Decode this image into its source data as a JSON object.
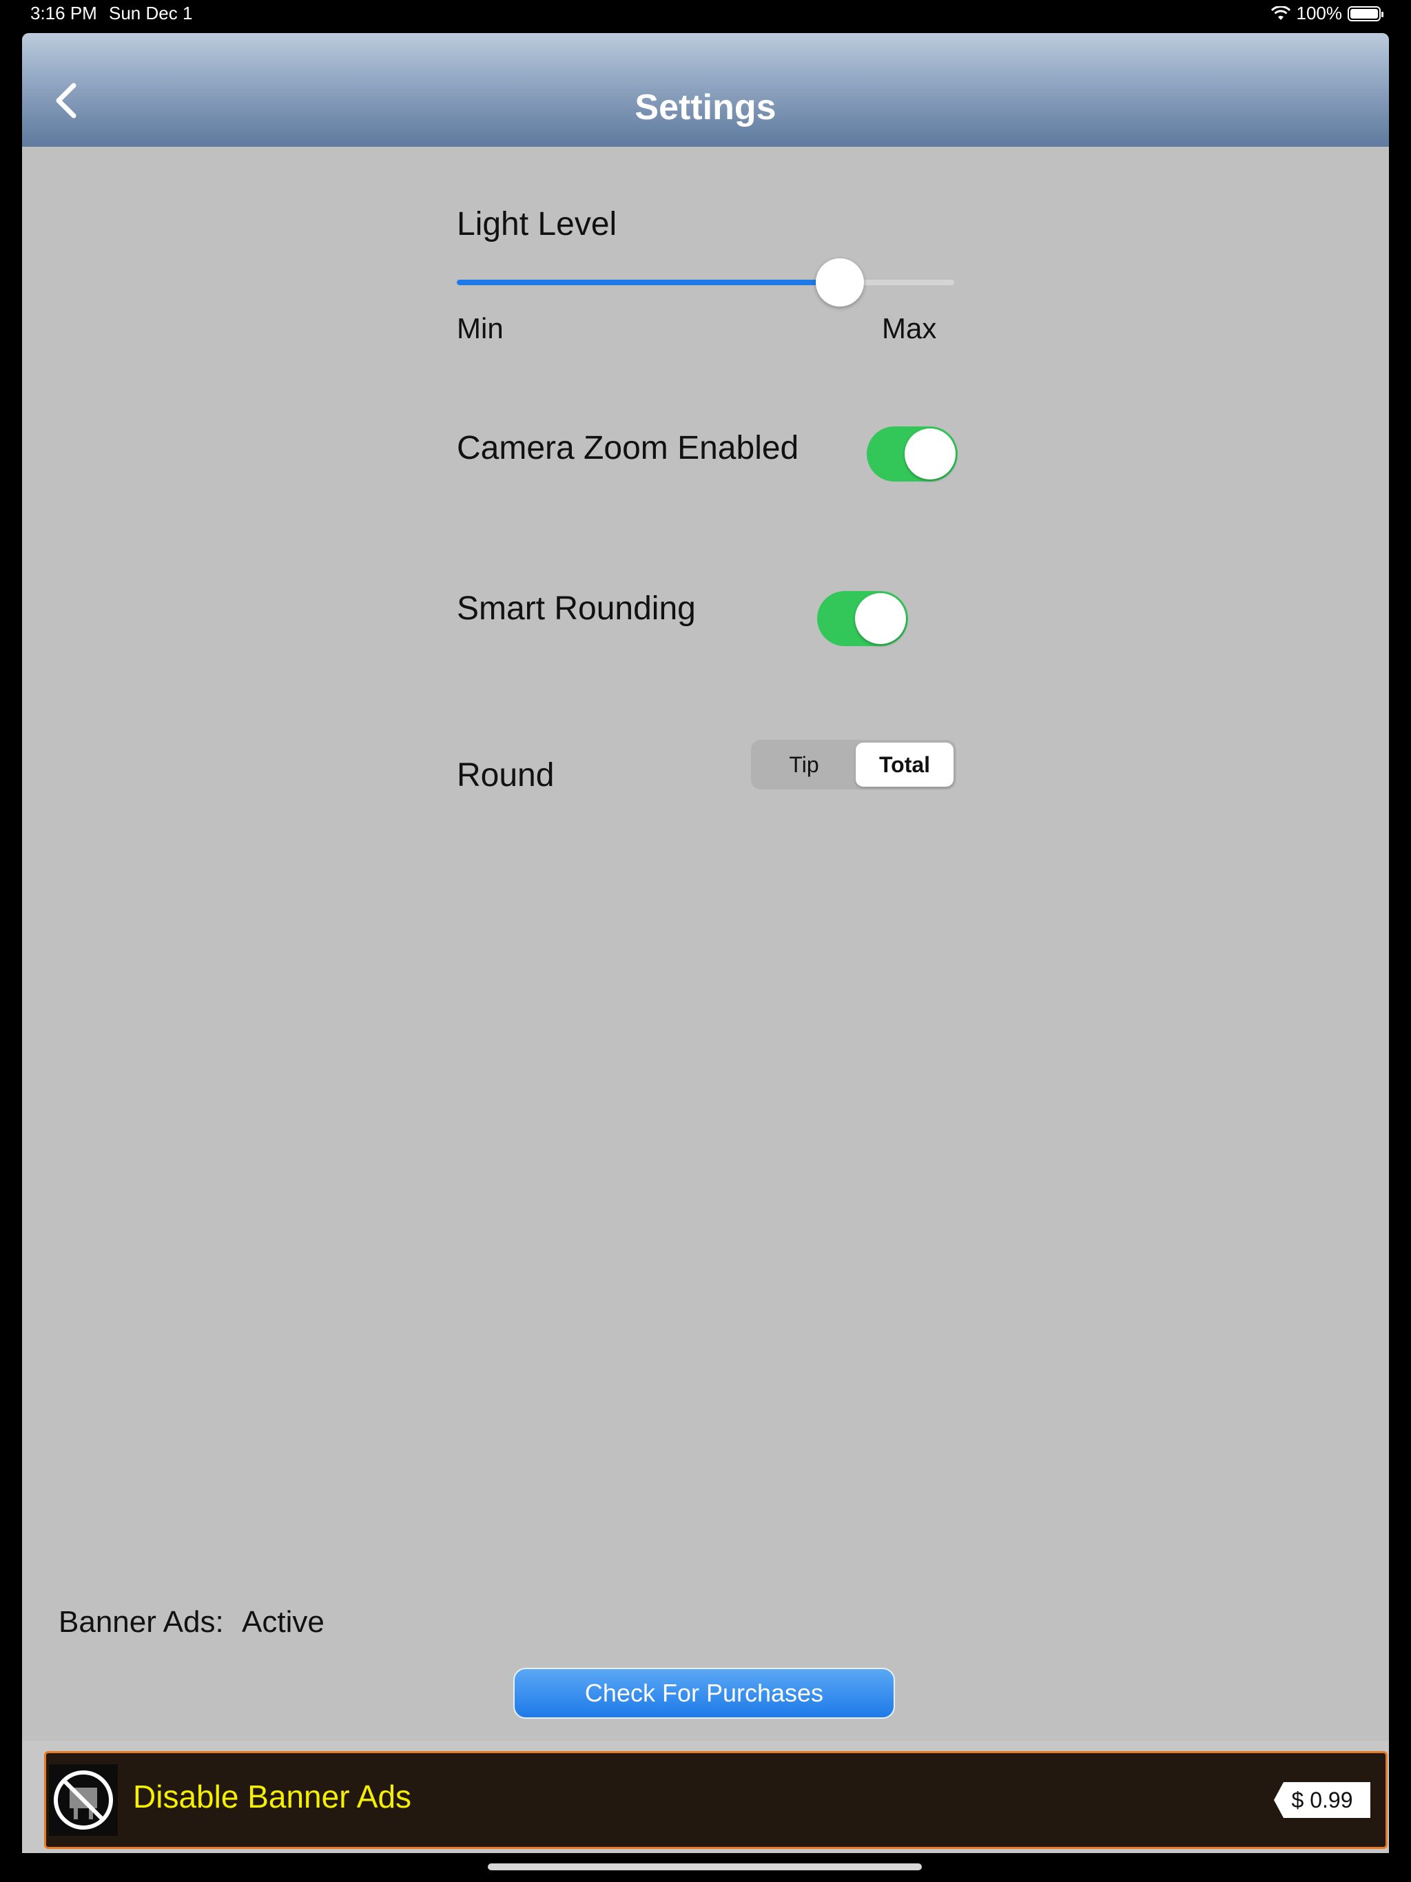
{
  "status_bar": {
    "time": "3:16 PM",
    "date": "Sun Dec 1",
    "battery": "100%",
    "battery_level": 1.0
  },
  "nav": {
    "title": "Settings"
  },
  "light_level": {
    "label": "Light Level",
    "min_label": "Min",
    "max_label": "Max",
    "value": 0.77
  },
  "camera_zoom": {
    "label": "Camera Zoom Enabled",
    "enabled": true
  },
  "smart_rounding": {
    "label": "Smart Rounding",
    "enabled": true
  },
  "round": {
    "label": "Round",
    "options": [
      "Tip",
      "Total"
    ],
    "selected": "Total"
  },
  "banner_ads": {
    "label": "Banner Ads:",
    "status": "Active"
  },
  "check_purchases": {
    "label": "Check For Purchases"
  },
  "ad": {
    "text": "Disable Banner Ads",
    "price": "$ 0.99"
  },
  "colors": {
    "accent_blue": "#1e7ae8",
    "toggle_green": "#33c759",
    "ad_text_yellow": "#f5f000",
    "ad_border_orange": "#e57a21"
  }
}
